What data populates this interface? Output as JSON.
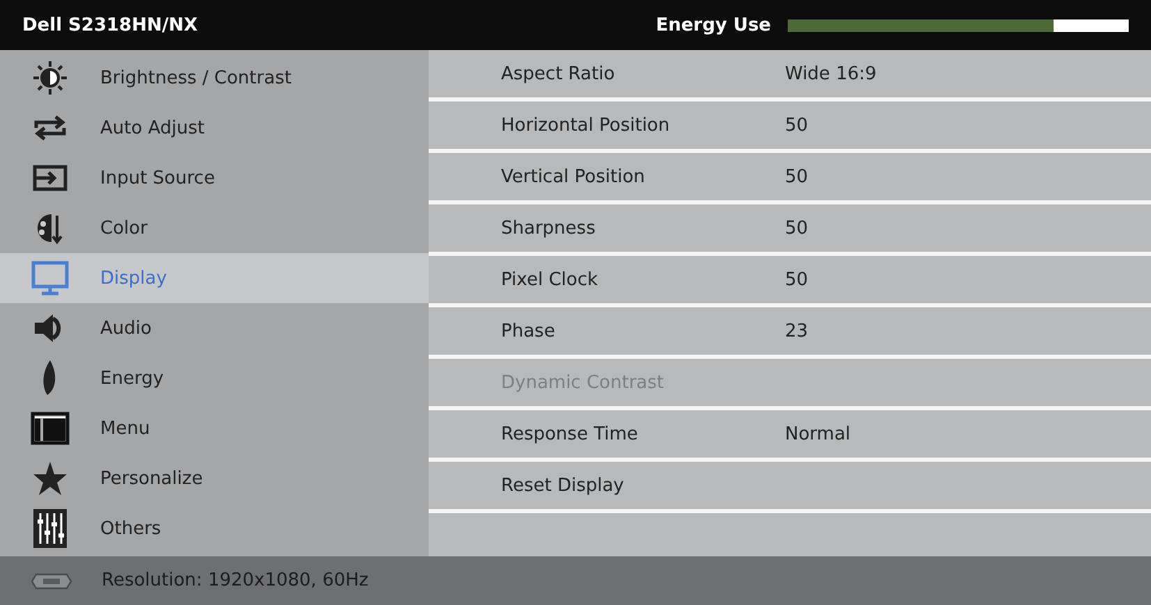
{
  "header": {
    "title": "Dell S2318HN/NX",
    "energy_label": "Energy Use",
    "energy": {
      "level": 0.78
    }
  },
  "sidebar": {
    "items": [
      {
        "label": "Brightness / Contrast",
        "selected": false
      },
      {
        "label": "Auto Adjust",
        "selected": false
      },
      {
        "label": "Input Source",
        "selected": false
      },
      {
        "label": "Color",
        "selected": false
      },
      {
        "label": "Display",
        "selected": true
      },
      {
        "label": "Audio",
        "selected": false
      },
      {
        "label": "Energy",
        "selected": false
      },
      {
        "label": "Menu",
        "selected": false
      },
      {
        "label": "Personalize",
        "selected": false
      },
      {
        "label": "Others",
        "selected": false
      }
    ]
  },
  "settings": [
    {
      "label": "Aspect Ratio",
      "value": "Wide 16:9",
      "disabled": false
    },
    {
      "label": "Horizontal Position",
      "value": "50",
      "disabled": false
    },
    {
      "label": "Vertical Position",
      "value": "50",
      "disabled": false
    },
    {
      "label": "Sharpness",
      "value": "50",
      "disabled": false
    },
    {
      "label": "Pixel Clock",
      "value": "50",
      "disabled": false
    },
    {
      "label": "Phase",
      "value": "23",
      "disabled": false
    },
    {
      "label": "Dynamic Contrast",
      "disabled": true
    },
    {
      "label": "Response Time",
      "value": "Normal",
      "disabled": false
    },
    {
      "label": "Reset Display",
      "disabled": false
    }
  ],
  "status_bar": {
    "text": "Resolution: 1920x1080, 60Hz"
  }
}
